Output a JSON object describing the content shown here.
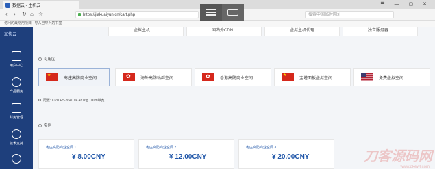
{
  "browser": {
    "tab_title": "数据云 - 主机云",
    "window_controls": "☰ — ▢ ✕",
    "url": "https://jiakuaiyun.cn/cart.php",
    "search_placeholder": "搜索中国临时网址",
    "bookmarks": "访问的最常用项目   ·   导入已导入的书签"
  },
  "sidebar": {
    "logo": "加快云",
    "items": [
      {
        "label": "用户中心",
        "icon": "home-icon"
      },
      {
        "label": "产品服务",
        "icon": "cloud-icon"
      },
      {
        "label": "财务管理",
        "icon": "wallet-icon"
      },
      {
        "label": "技术支持",
        "icon": "support-icon"
      },
      {
        "label": "",
        "icon": "user-icon"
      }
    ]
  },
  "top_products": [
    "虚拟主机",
    "国内外CDN",
    "虚拟主机代理",
    "独立服务器"
  ],
  "section_region": "可用区",
  "regions": [
    {
      "label": "枣庄高防商业空间",
      "flag": "cn"
    },
    {
      "label": "海外高防站群空间",
      "flag": "hk"
    },
    {
      "label": "香港高防商业空间",
      "flag": "hk"
    },
    {
      "label": "宝塔面板虚拟空间",
      "flag": "cn"
    },
    {
      "label": "免费虚拟空间",
      "flag": "us"
    }
  ],
  "config_note": "配置: CPU E5-2640 v4 4h16g 100m带宽",
  "section_instance": "实例",
  "prices": [
    {
      "title": "枣庄高防商业空间 1",
      "price": "¥ 8.00CNY"
    },
    {
      "title": "枣庄高防商业空间 2",
      "price": "¥ 12.00CNY"
    },
    {
      "title": "枣庄高防商业空间 3",
      "price": "¥ 20.00CNY"
    }
  ],
  "watermark": "刀客源码网",
  "watermark_url": "www.dkewl.com",
  "colors": {
    "sidebar": "#1e3f7c",
    "accent": "#1e55a8"
  }
}
